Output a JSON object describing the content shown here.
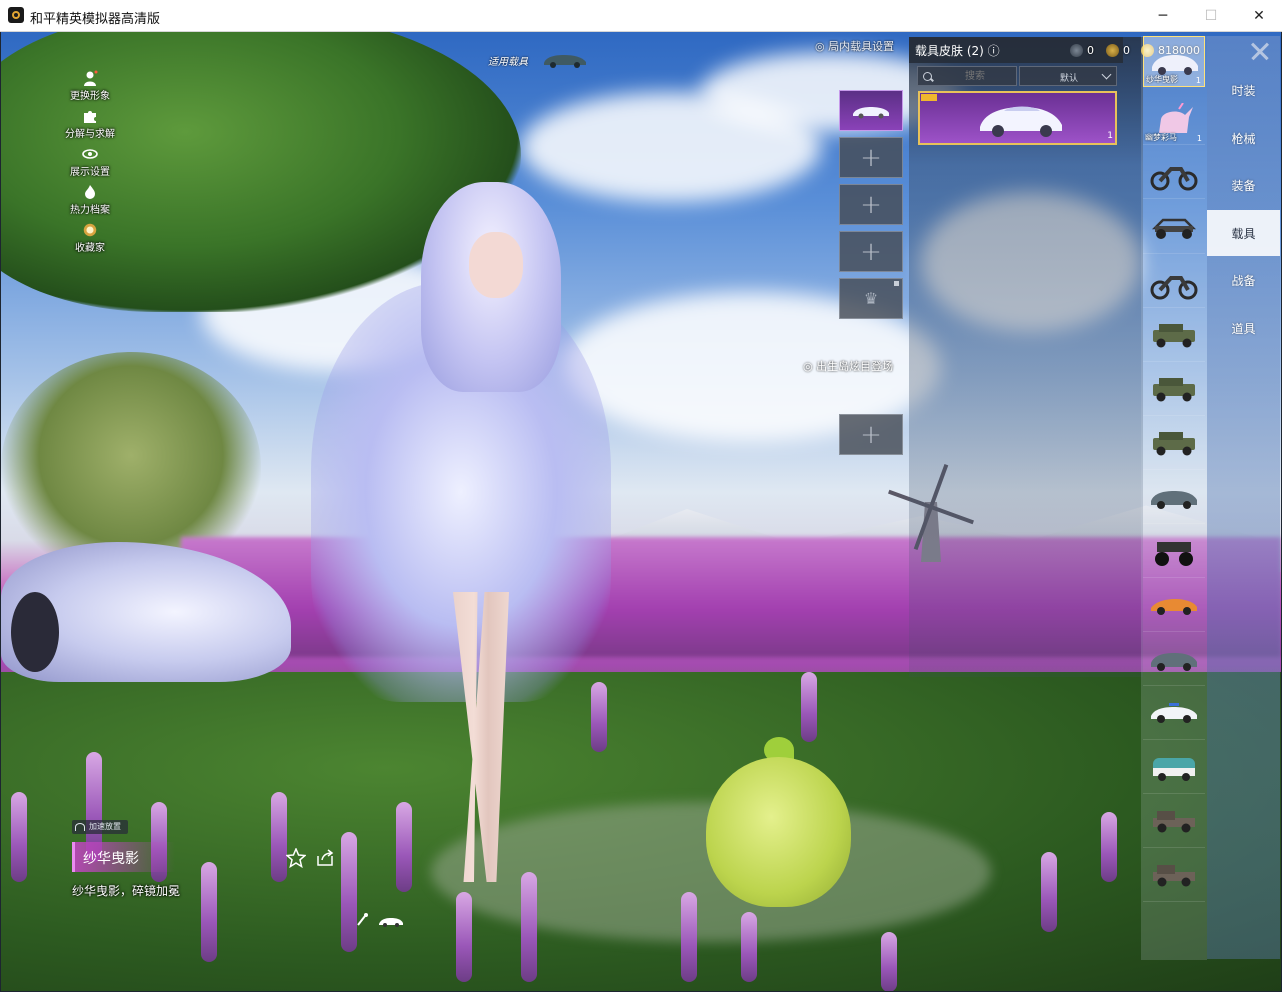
{
  "window": {
    "title": "和平精英模拟器高清版",
    "buttons": {
      "minimize": "─",
      "maximize": "☐",
      "close": "✕"
    }
  },
  "left_menu": [
    {
      "label": "更换形象",
      "icon": "person-icon"
    },
    {
      "label": "分解与求解",
      "icon": "puzzle-icon"
    },
    {
      "label": "展示设置",
      "icon": "eye-icon"
    },
    {
      "label": "热力档案",
      "icon": "flame-icon"
    },
    {
      "label": "收藏家",
      "icon": "collector-badge-icon"
    }
  ],
  "applicable_vehicle": {
    "label": "适用载具"
  },
  "loadout": {
    "title": "局内载具设置",
    "entrance_title": "出生岛炫目登场"
  },
  "skin_panel": {
    "title": "载具皮肤 (2)",
    "help_icon": "question-icon",
    "search_placeholder": "搜索",
    "sort_label": "默认",
    "selected_card_count": "1"
  },
  "currency": {
    "c1": "0",
    "c2": "0",
    "c3": "818000"
  },
  "vehicles": [
    {
      "label": "纱华曳影",
      "count": "1",
      "icon": "sedan-white-icon"
    },
    {
      "label": "幽梦彩马",
      "count": "1",
      "icon": "unicorn-icon"
    },
    {
      "label": "",
      "count": "",
      "icon": "motorcycle-icon"
    },
    {
      "label": "",
      "count": "",
      "icon": "buggy-icon"
    },
    {
      "label": "",
      "count": "",
      "icon": "motorcycle-icon"
    },
    {
      "label": "",
      "count": "",
      "icon": "jeep-icon"
    },
    {
      "label": "",
      "count": "",
      "icon": "jeep-icon"
    },
    {
      "label": "",
      "count": "",
      "icon": "jeep-icon"
    },
    {
      "label": "",
      "count": "",
      "icon": "sedan-icon"
    },
    {
      "label": "",
      "count": "",
      "icon": "monster-truck-icon"
    },
    {
      "label": "",
      "count": "",
      "icon": "sports-car-icon"
    },
    {
      "label": "",
      "count": "",
      "icon": "sedan-icon"
    },
    {
      "label": "",
      "count": "",
      "icon": "police-car-icon"
    },
    {
      "label": "",
      "count": "",
      "icon": "van-icon"
    },
    {
      "label": "",
      "count": "",
      "icon": "pickup-icon"
    },
    {
      "label": "",
      "count": "",
      "icon": "pickup-icon"
    }
  ],
  "categories": [
    {
      "label": "时装",
      "active": false
    },
    {
      "label": "枪械",
      "active": false
    },
    {
      "label": "装备",
      "active": false
    },
    {
      "label": "载具",
      "active": true
    },
    {
      "label": "战备",
      "active": false
    },
    {
      "label": "道具",
      "active": false
    }
  ],
  "bottom_info": {
    "accel_tag": "加速放置",
    "skin_name": "纱华曳影",
    "description": "纱华曳影，碎镜加冕"
  },
  "colors": {
    "accent_purple": "#9d52c8",
    "gold_border": "#e8c25a",
    "active_tab_bg": "#ffffff"
  }
}
